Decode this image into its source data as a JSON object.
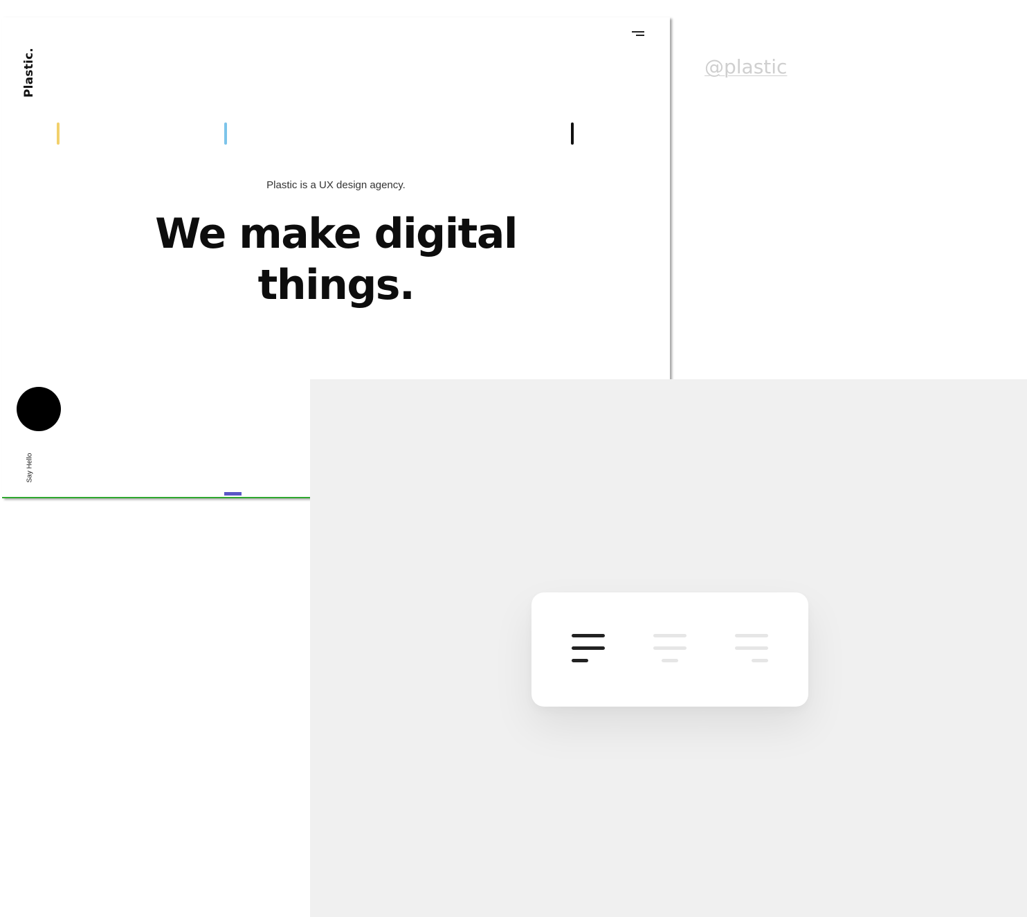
{
  "site": {
    "brand": "Plastic.",
    "tagline": "Plastic is a UX design agency.",
    "headline_line1": "We make digital",
    "headline_line2": "things.",
    "say_hello": "Say Hello",
    "accent_colors": {
      "yellow": "#f2d06b",
      "blue": "#7cc4ea",
      "black": "#111111",
      "scroll_indicator": "#5b56c6",
      "bottom_line": "#2fa82f"
    },
    "menu_icon": "hamburger-menu-icon"
  },
  "handle": {
    "label": "@plastic"
  },
  "alignment_widget": {
    "options": [
      {
        "name": "align-left",
        "icon": "align-left-icon",
        "active": true,
        "color": "#222222"
      },
      {
        "name": "align-center",
        "icon": "align-center-icon",
        "active": false,
        "color": "#e6e6e6"
      },
      {
        "name": "align-right",
        "icon": "align-right-icon",
        "active": false,
        "color": "#e6e6e6"
      }
    ]
  }
}
